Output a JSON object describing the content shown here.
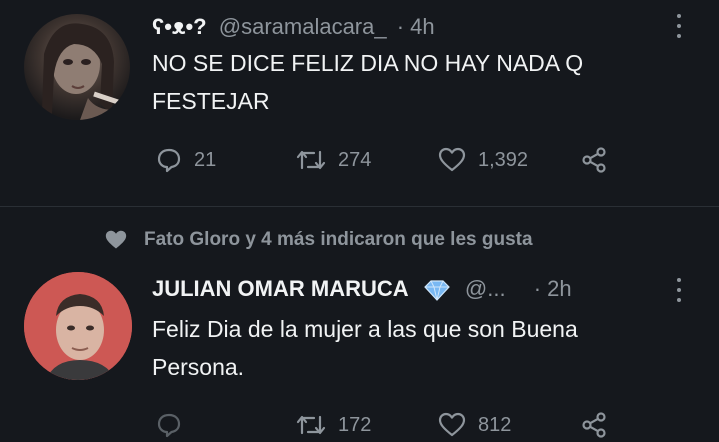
{
  "tweet1": {
    "name_glyph": "ʕ•ᴥ•?",
    "handle": "@saramalacara_",
    "time": "· 4h",
    "text_line1": "NO SE DICE FELIZ DIA NO HAY NADA Q",
    "text_line2": "FESTEJAR",
    "replies": "21",
    "retweets": "274",
    "likes": "1,392"
  },
  "liked_banner": {
    "text": "Fato Gloro y 4 más indicaron que les gusta"
  },
  "tweet2": {
    "name": "JULIAN OMAR MARUCA",
    "handle": "@...",
    "time": "· 2h",
    "text_line1": "Feliz Dia de la mujer a las que son Buena",
    "text_line2": "Persona.",
    "retweets": "172",
    "likes": "812"
  },
  "colors": {
    "background": "#15181d",
    "verified_badge": "#79b8f3",
    "muted": "#8e959c"
  }
}
